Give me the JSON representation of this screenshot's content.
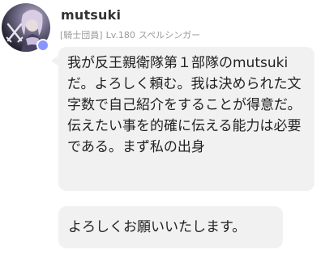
{
  "user": {
    "name": "mutsuki",
    "rank": "[騎士団員]",
    "level": "Lv.180",
    "job": "スペルシンガー"
  },
  "messages": [
    {
      "text": "我が反王親衛隊第１部隊のmutsukiだ。よろしく頼む。我は決められた文字数で自己紹介をすることが得意だ。伝えたい事を的確に伝える能力は必要である。まず私の出身"
    },
    {
      "text": "よろしくお願いいたします。"
    }
  ],
  "colors": {
    "bubble": "#f1f1f1",
    "online_status": "#8a96ff",
    "meta_text": "#9a9a9a"
  },
  "icons": {
    "avatar": "character-portrait-with-crossed-swords-emblem",
    "status": "online-status-dot"
  }
}
